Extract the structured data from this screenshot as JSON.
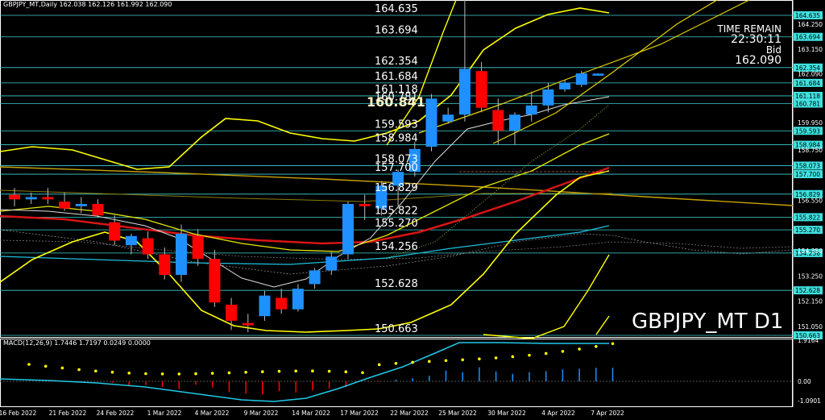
{
  "header": {
    "title_info": "GBPJPY_MT,Daily  162.038 162.126 161.992 162.090"
  },
  "macd": {
    "label": "MACD(12,26,9) 1.7446 1.7197 0.0249 0.0000",
    "ticks": [
      "1.9164",
      "0.00",
      "-1.0901"
    ]
  },
  "timer": {
    "time_remain_label": "TIME REMAIN",
    "time_remain_value": "22:30:11",
    "bid_label": "Bid",
    "bid_value": "162.090"
  },
  "symbol_watermark": "GBPJPY_MT D1",
  "price_axis": [
    "164.250",
    "163.150",
    "162.090",
    "159.950",
    "158.750",
    "156.550",
    "154.350",
    "153.250",
    "152.150",
    "151.050"
  ],
  "horizontal_levels": [
    "164.635",
    "163.694",
    "162.354",
    "161.684",
    "161.118",
    "160.781",
    "159.593",
    "158.984",
    "158.073",
    "157.700",
    "156.829",
    "155.822",
    "155.270",
    "154.256",
    "152.628",
    "150.663"
  ],
  "highlight_level": "160.841",
  "date_axis": [
    "16 Feb 2022",
    "21 Feb 2022",
    "24 Feb 2022",
    "1 Mar 2022",
    "4 Mar 2022",
    "9 Mar 2022",
    "14 Mar 2022",
    "17 Mar 2022",
    "22 Mar 2022",
    "25 Mar 2022",
    "30 Mar 2022",
    "4 Apr 2022",
    "7 Apr 2022"
  ],
  "colors": {
    "up": "#1e90ff",
    "down": "#ff0000",
    "level_line": "#40d0d0",
    "bollinger": "#ffff00",
    "ma_red": "#d81414",
    "ma_cyan": "#20c0e0",
    "tag_bg": "#40e0e0"
  },
  "chart_data": {
    "type": "candlestick",
    "title": "GBPJPY_MT,Daily",
    "ylim": [
      150.5,
      165.4
    ],
    "candles": [
      {
        "o": 156.8,
        "h": 157.1,
        "l": 156.3,
        "c": 156.6
      },
      {
        "o": 156.6,
        "h": 156.9,
        "l": 156.4,
        "c": 156.7
      },
      {
        "o": 156.7,
        "h": 157.1,
        "l": 156.4,
        "c": 156.6
      },
      {
        "o": 156.5,
        "h": 156.9,
        "l": 156.1,
        "c": 156.2
      },
      {
        "o": 156.3,
        "h": 156.7,
        "l": 156.0,
        "c": 156.4
      },
      {
        "o": 156.4,
        "h": 156.6,
        "l": 155.8,
        "c": 155.9
      },
      {
        "o": 155.6,
        "h": 155.9,
        "l": 154.6,
        "c": 154.8
      },
      {
        "o": 154.6,
        "h": 155.1,
        "l": 154.2,
        "c": 155.0
      },
      {
        "o": 154.9,
        "h": 155.2,
        "l": 154.0,
        "c": 154.2
      },
      {
        "o": 154.2,
        "h": 154.5,
        "l": 153.1,
        "c": 153.3
      },
      {
        "o": 153.3,
        "h": 155.5,
        "l": 153.0,
        "c": 155.1
      },
      {
        "o": 155.0,
        "h": 155.3,
        "l": 153.7,
        "c": 154.0
      },
      {
        "o": 154.0,
        "h": 154.4,
        "l": 151.9,
        "c": 152.1
      },
      {
        "o": 152.0,
        "h": 152.3,
        "l": 150.9,
        "c": 151.3
      },
      {
        "o": 151.2,
        "h": 151.6,
        "l": 150.8,
        "c": 151.1
      },
      {
        "o": 151.5,
        "h": 152.6,
        "l": 151.3,
        "c": 152.4
      },
      {
        "o": 152.3,
        "h": 152.7,
        "l": 151.6,
        "c": 151.8
      },
      {
        "o": 151.8,
        "h": 152.9,
        "l": 151.7,
        "c": 152.7
      },
      {
        "o": 152.9,
        "h": 153.6,
        "l": 152.7,
        "c": 153.5
      },
      {
        "o": 153.5,
        "h": 154.3,
        "l": 153.3,
        "c": 154.1
      },
      {
        "o": 154.2,
        "h": 156.5,
        "l": 154.0,
        "c": 156.4
      },
      {
        "o": 156.4,
        "h": 156.8,
        "l": 155.7,
        "c": 156.3
      },
      {
        "o": 156.2,
        "h": 157.4,
        "l": 155.9,
        "c": 157.2
      },
      {
        "o": 157.2,
        "h": 157.9,
        "l": 156.2,
        "c": 157.8
      },
      {
        "o": 157.8,
        "h": 159.1,
        "l": 157.6,
        "c": 158.8
      },
      {
        "o": 158.9,
        "h": 161.2,
        "l": 158.7,
        "c": 161.0
      },
      {
        "o": 160.0,
        "h": 160.6,
        "l": 159.9,
        "c": 160.3
      },
      {
        "o": 160.3,
        "h": 165.4,
        "l": 160.0,
        "c": 162.3
      },
      {
        "o": 162.2,
        "h": 162.6,
        "l": 160.4,
        "c": 160.6
      },
      {
        "o": 160.5,
        "h": 161.0,
        "l": 159.0,
        "c": 159.6
      },
      {
        "o": 159.6,
        "h": 160.4,
        "l": 159.0,
        "c": 160.3
      },
      {
        "o": 160.3,
        "h": 161.3,
        "l": 160.0,
        "c": 160.7
      },
      {
        "o": 160.7,
        "h": 161.7,
        "l": 160.4,
        "c": 161.4
      },
      {
        "o": 161.4,
        "h": 161.8,
        "l": 161.3,
        "c": 161.7
      },
      {
        "o": 161.6,
        "h": 162.2,
        "l": 161.5,
        "c": 162.1
      },
      {
        "o": 162.0,
        "h": 162.1,
        "l": 162.0,
        "c": 162.09
      }
    ]
  }
}
